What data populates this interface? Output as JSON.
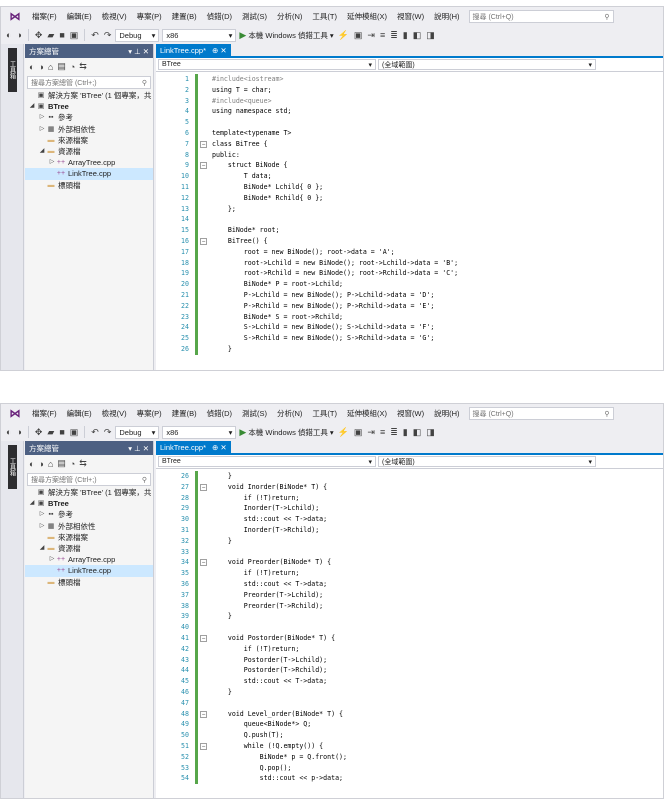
{
  "menu": [
    "檔案(F)",
    "編輯(E)",
    "檢視(V)",
    "專案(P)",
    "建置(B)",
    "偵錯(D)",
    "測試(S)",
    "分析(N)",
    "工具(T)",
    "延伸模組(X)",
    "視窗(W)",
    "說明(H)"
  ],
  "search_placeholder": "搜尋 (Ctrl+Q)",
  "toolbar": {
    "config": "Debug",
    "platform": "x86",
    "run_label": "本機 Windows 偵錯工具"
  },
  "side_tab": "工具箱",
  "explorer": {
    "title": "方案總管",
    "pin": "▾ ⊥ ✕",
    "search_placeholder": "搜尋方案總管 (Ctrl+;)",
    "tree": [
      {
        "label": "解決方案 'BTree' (1 個專案，共",
        "depth": 0,
        "arrow": "",
        "icon": "▣",
        "selected": false
      },
      {
        "label": "BTree",
        "depth": 0,
        "arrow": "◢",
        "icon": "▣",
        "selected": false
      },
      {
        "label": "參考",
        "depth": 1,
        "arrow": "▷",
        "icon": "▪▪",
        "selected": false
      },
      {
        "label": "外部相依性",
        "depth": 1,
        "arrow": "▷",
        "icon": "▦",
        "selected": false
      },
      {
        "label": "來源檔案",
        "depth": 1,
        "arrow": "",
        "icon": "▬",
        "selected": false
      },
      {
        "label": "資源檔",
        "depth": 1,
        "arrow": "◢",
        "icon": "▬",
        "selected": false
      },
      {
        "label": "ArrayTree.cpp",
        "depth": 2,
        "arrow": "▷",
        "icon": "++",
        "selected": false
      },
      {
        "label": "LinkTree.cpp",
        "depth": 2,
        "arrow": "",
        "icon": "++",
        "selected": true
      },
      {
        "label": "標頭檔",
        "depth": 1,
        "arrow": "",
        "icon": "▬",
        "selected": false
      }
    ]
  },
  "editor": {
    "tab_label": "LinkTree.cpp*",
    "tab_close": "⊕ ✕",
    "nav_left": "BTree",
    "nav_right": "(全域範圍)"
  },
  "code_top": [
    {
      "n": "1",
      "text": "#include<iostream>"
    },
    {
      "n": "2",
      "text": "using T = char;"
    },
    {
      "n": "3",
      "text": "#include<queue>"
    },
    {
      "n": "4",
      "text": "using namespace std;"
    },
    {
      "n": "5",
      "text": ""
    },
    {
      "n": "6",
      "text": "template<typename T>"
    },
    {
      "n": "7",
      "text": "class BiTree {"
    },
    {
      "n": "8",
      "text": "public:"
    },
    {
      "n": "9",
      "text": "    struct BiNode {"
    },
    {
      "n": "10",
      "text": "        T data;"
    },
    {
      "n": "11",
      "text": "        BiNode* Lchild{ 0 };"
    },
    {
      "n": "12",
      "text": "        BiNode* Rchild{ 0 };"
    },
    {
      "n": "13",
      "text": "    };"
    },
    {
      "n": "14",
      "text": ""
    },
    {
      "n": "15",
      "text": "    BiNode* root;"
    },
    {
      "n": "16",
      "text": "    BiTree() {"
    },
    {
      "n": "17",
      "text": "        root = new BiNode(); root->data = 'A';"
    },
    {
      "n": "18",
      "text": "        root->Lchild = new BiNode(); root->Lchild->data = 'B';"
    },
    {
      "n": "19",
      "text": "        root->Rchild = new BiNode(); root->Rchild->data = 'C';"
    },
    {
      "n": "20",
      "text": "        BiNode* P = root->Lchild;"
    },
    {
      "n": "21",
      "text": "        P->Lchild = new BiNode(); P->Lchild->data = 'D';"
    },
    {
      "n": "22",
      "text": "        P->Rchild = new BiNode(); P->Rchild->data = 'E';"
    },
    {
      "n": "23",
      "text": "        BiNode* S = root->Rchild;"
    },
    {
      "n": "24",
      "text": "        S->Lchild = new BiNode(); S->Lchild->data = 'F';"
    },
    {
      "n": "25",
      "text": "        S->Rchild = new BiNode(); S->Rchild->data = 'G';"
    },
    {
      "n": "26",
      "text": "    }"
    }
  ],
  "code_bottom": [
    {
      "n": "26",
      "text": "    }"
    },
    {
      "n": "27",
      "text": "    void Inorder(BiNode* T) {"
    },
    {
      "n": "28",
      "text": "        if (!T)return;"
    },
    {
      "n": "29",
      "text": "        Inorder(T->Lchild);"
    },
    {
      "n": "30",
      "text": "        std::cout << T->data;"
    },
    {
      "n": "31",
      "text": "        Inorder(T->Rchild);"
    },
    {
      "n": "32",
      "text": "    }"
    },
    {
      "n": "33",
      "text": ""
    },
    {
      "n": "34",
      "text": "    void Preorder(BiNode* T) {"
    },
    {
      "n": "35",
      "text": "        if (!T)return;"
    },
    {
      "n": "36",
      "text": "        std::cout << T->data;"
    },
    {
      "n": "37",
      "text": "        Preorder(T->Lchild);"
    },
    {
      "n": "38",
      "text": "        Preorder(T->Rchild);"
    },
    {
      "n": "39",
      "text": "    }"
    },
    {
      "n": "40",
      "text": ""
    },
    {
      "n": "41",
      "text": "    void Postorder(BiNode* T) {"
    },
    {
      "n": "42",
      "text": "        if (!T)return;"
    },
    {
      "n": "43",
      "text": "        Postorder(T->Lchild);"
    },
    {
      "n": "44",
      "text": "        Postorder(T->Rchild);"
    },
    {
      "n": "45",
      "text": "        std::cout << T->data;"
    },
    {
      "n": "46",
      "text": "    }"
    },
    {
      "n": "47",
      "text": ""
    },
    {
      "n": "48",
      "text": "    void Level_order(BiNode* T) {"
    },
    {
      "n": "49",
      "text": "        queue<BiNode*> Q;"
    },
    {
      "n": "50",
      "text": "        Q.push(T);"
    },
    {
      "n": "51",
      "text": "        while (!Q.empty()) {"
    },
    {
      "n": "52",
      "text": "            BiNode* p = Q.front();"
    },
    {
      "n": "53",
      "text": "            Q.pop();"
    },
    {
      "n": "54",
      "text": "            std::cout << p->data;"
    }
  ],
  "colors": {
    "accent": "#007acc",
    "explorer_title": "#4d6082",
    "line_number": "#2b91af",
    "changed_bar": "#57a64a",
    "selection": "#cce8ff"
  }
}
